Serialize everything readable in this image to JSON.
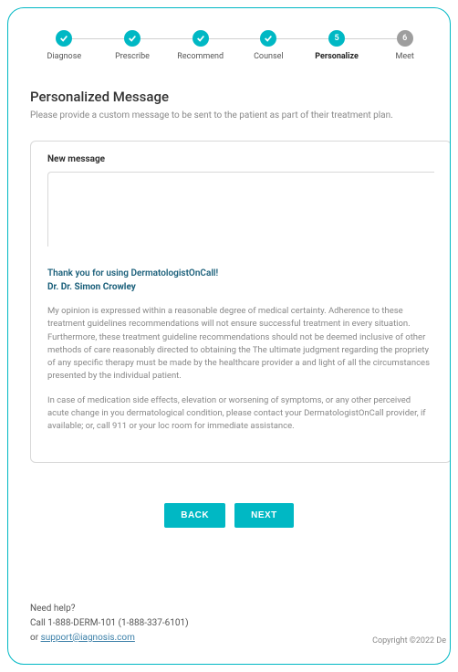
{
  "stepper": {
    "steps": [
      {
        "label": "Diagnose",
        "state": "done"
      },
      {
        "label": "Prescribe",
        "state": "done"
      },
      {
        "label": "Recommend",
        "state": "done"
      },
      {
        "label": "Counsel",
        "state": "done"
      },
      {
        "label": "Personalize",
        "state": "current",
        "num": "5"
      },
      {
        "label": "Meet",
        "state": "pending",
        "num": "6"
      }
    ]
  },
  "section": {
    "title": "Personalized Message",
    "subtitle": "Please provide a custom message to be sent to the patient as part of their treatment plan."
  },
  "message": {
    "label": "New message",
    "value": "",
    "thanks": "Thank you for using DermatologistOnCall!",
    "doctor": "Dr. Dr. Simon Crowley",
    "disclaimer1": "My opinion is expressed within a reasonable degree of medical certainty. Adherence to these treatment guidelines recommendations will not ensure successful treatment in every situation. Furthermore, these treatment guideline recommendations should not be deemed inclusive of other methods of care reasonably directed to obtaining the The ultimate judgment regarding the propriety of any specific therapy must be made by the healthcare provider a and light of all the circumstances presented by the individual patient.",
    "disclaimer2": "In case of medication side effects, elevation or worsening of symptoms, or any other perceived acute change in you dermatological condition, please contact your DermatologistOnCall provider, if available; or, call 911 or your loc room for immediate assistance."
  },
  "buttons": {
    "back": "BACK",
    "next": "NEXT"
  },
  "footer": {
    "help_label": "Need help?",
    "phone_line": "Call 1-888-DERM-101 (1-888-337-6101)",
    "or": "or  ",
    "email": "support@iagnosis.com",
    "copyright": "Copyright ©2022 De"
  }
}
